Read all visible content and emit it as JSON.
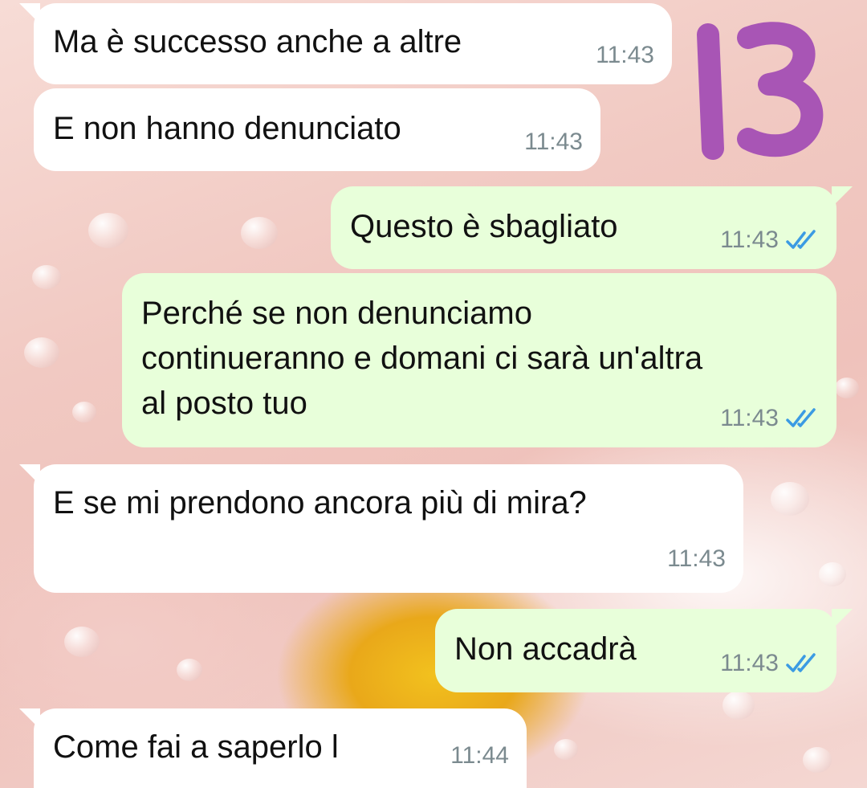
{
  "colors": {
    "incoming_bubble": "#ffffff",
    "outgoing_bubble": "#e8ffda",
    "timestamp": "#7b8a8f",
    "read_ticks": "#3b9be3",
    "annotation": "#a855b5"
  },
  "annotation": {
    "label": "13"
  },
  "messages": [
    {
      "direction": "incoming",
      "text": "Ma è successo anche a altre",
      "time": "11:43"
    },
    {
      "direction": "incoming",
      "text": "E non hanno denunciato",
      "time": "11:43"
    },
    {
      "direction": "outgoing",
      "text": "Questo è sbagliato",
      "time": "11:43",
      "status": "read"
    },
    {
      "direction": "outgoing",
      "text": "Perché se non denunciamo\ncontinueranno e domani ci sarà un'altra\nal posto tuo",
      "time": "11:43",
      "status": "read"
    },
    {
      "direction": "incoming",
      "text": "E se mi prendono ancora più di mira?",
      "time": "11:43"
    },
    {
      "direction": "outgoing",
      "text": "Non accadrà",
      "time": "11:43",
      "status": "read"
    },
    {
      "direction": "incoming",
      "text": "Come fai a saperlo l",
      "time": "11:44"
    }
  ]
}
